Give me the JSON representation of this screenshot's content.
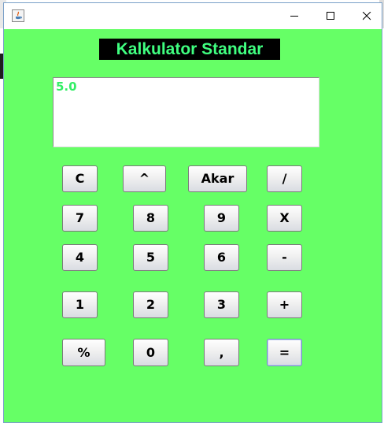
{
  "window": {
    "min_icon": "minimize-icon",
    "max_icon": "maximize-icon",
    "close_icon": "close-icon",
    "app_icon": "java-icon"
  },
  "heading": "Kalkulator Standar",
  "display_value": "5.0",
  "buttons": {
    "clear": "C",
    "power": "^",
    "sqrt": "Akar",
    "divide": "/",
    "seven": "7",
    "eight": "8",
    "nine": "9",
    "multiply": "X",
    "four": "4",
    "five": "5",
    "six": "6",
    "minus": "-",
    "one": "1",
    "two": "2",
    "three": "3",
    "plus": "+",
    "percent": "%",
    "zero": "0",
    "comma": ",",
    "equals": "="
  },
  "colors": {
    "background": "#66ff66",
    "heading_bg": "#000000",
    "heading_text": "#40ff80",
    "display_text": "#33ee66"
  }
}
